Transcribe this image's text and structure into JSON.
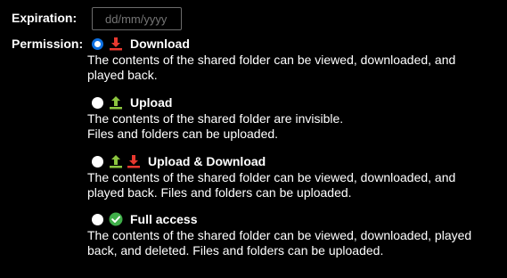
{
  "expiration": {
    "label": "Expiration:",
    "placeholder": "dd/mm/yyyy",
    "value": ""
  },
  "permission": {
    "label": "Permission:",
    "options": [
      {
        "title": "Download",
        "selected": true,
        "icons": [
          "download-arrow-icon"
        ],
        "desc_lines": [
          "The contents of the shared folder can be viewed, downloaded, and",
          "played back."
        ]
      },
      {
        "title": "Upload",
        "selected": false,
        "icons": [
          "upload-arrow-icon"
        ],
        "desc_lines": [
          "The contents of the shared folder are invisible.",
          "Files and folders can be uploaded."
        ]
      },
      {
        "title": "Upload & Download",
        "selected": false,
        "icons": [
          "upload-arrow-icon",
          "download-arrow-icon"
        ],
        "desc_lines": [
          "The contents of the shared folder can be viewed, downloaded, and",
          "played back. Files and folders can be uploaded."
        ]
      },
      {
        "title": "Full access",
        "selected": false,
        "icons": [
          "checkmark-circle-icon"
        ],
        "desc_lines": [
          "The contents of the shared folder can be viewed, downloaded, played",
          "back, and deleted. Files and folders can be uploaded."
        ]
      }
    ]
  },
  "colors": {
    "background": "#000000",
    "text": "#ffffff",
    "radio_selected": "#0d6fe0",
    "download_icon": "#e8382f",
    "upload_icon": "#8cc63f",
    "full_access_icon": "#3fae49"
  }
}
